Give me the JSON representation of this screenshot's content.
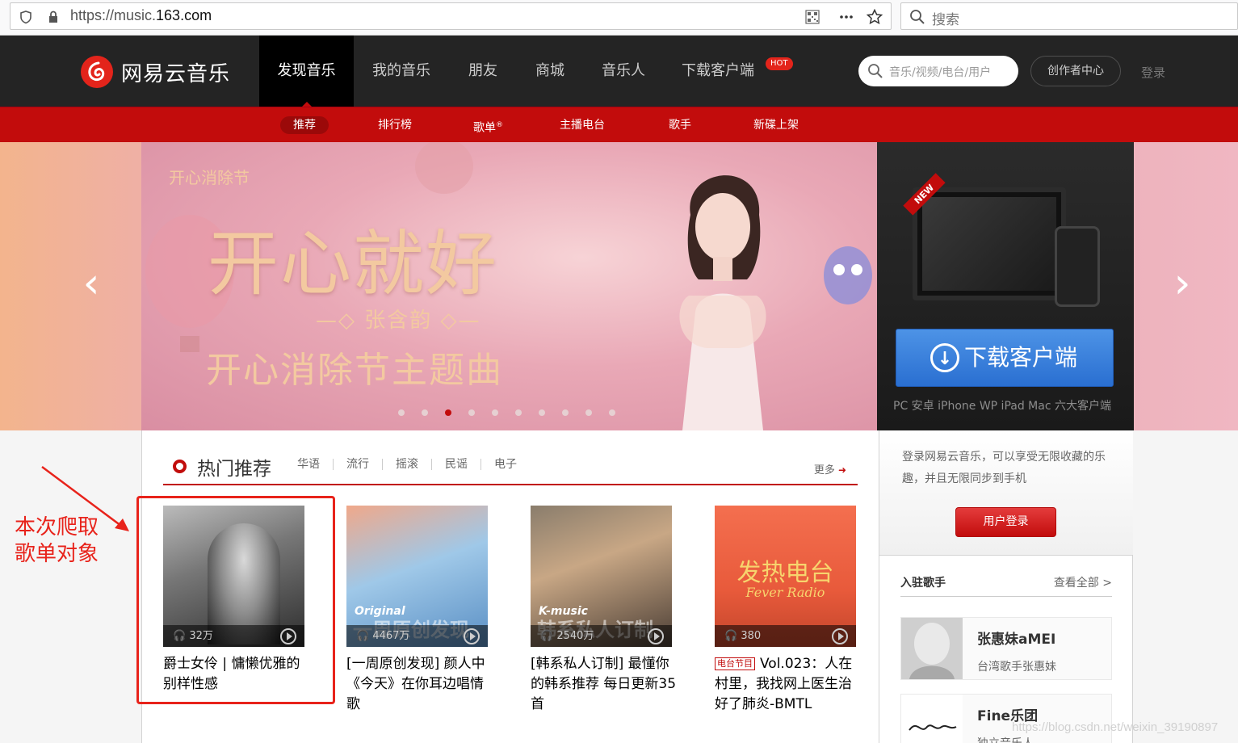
{
  "browser": {
    "url_prefix": "https://music.",
    "url_domain": "163.com",
    "search_placeholder": "搜索"
  },
  "topnav": {
    "logo": "网易云音乐",
    "items": [
      "发现音乐",
      "我的音乐",
      "朋友",
      "商城",
      "音乐人",
      "下载客户端"
    ],
    "hot_badge": "HOT",
    "search_placeholder": "音乐/视频/电台/用户",
    "creator": "创作者中心",
    "login": "登录"
  },
  "subnav": {
    "items": [
      "推荐",
      "排行榜",
      "歌单",
      "主播电台",
      "歌手",
      "新碟上架"
    ],
    "reg_mark": "®"
  },
  "banner": {
    "logo": "开心消除节",
    "title": "开心就好",
    "artist": "张含韵",
    "subtitle": "开心消除节主题曲",
    "new_tag": "NEW",
    "download_label": "下载客户端",
    "download_note": "PC 安卓 iPhone WP iPad Mac 六大客户端",
    "dots_count": 10,
    "active_dot": 2
  },
  "hot": {
    "title": "热门推荐",
    "tags": [
      "华语",
      "流行",
      "摇滚",
      "民谣",
      "电子"
    ],
    "more": "更多",
    "cards": [
      {
        "plays": "32万",
        "title": "爵士女伶 | 慵懒优雅的别样性感",
        "label": "",
        "big": ""
      },
      {
        "plays": "4467万",
        "title": "[一周原创发现] 颜人中《今天》在你耳边唱情歌",
        "label": "Original",
        "big": "一周原创发现"
      },
      {
        "plays": "2540万",
        "title": "[韩系私人订制] 最懂你的韩系推荐 每日更新35首",
        "label": "K-music",
        "big": "韩系私人订制"
      },
      {
        "plays": "380",
        "title": "Vol.023：人在村里，我找网上医生治好了肺炎-BMTL",
        "radio_tag": "电台节目",
        "cover_title": "发热电台",
        "cover_sub": "Fever Radio"
      }
    ]
  },
  "annotation": {
    "line1": "本次爬取",
    "line2": "歌单对象"
  },
  "sidebar": {
    "login_text": "登录网易云音乐，可以享受无限收藏的乐趣，并且无限同步到手机",
    "login_button": "用户登录",
    "singers_title": "入驻歌手",
    "view_all": "查看全部 >",
    "singers": [
      {
        "name": "张惠妹aMEI",
        "desc": "台湾歌手张惠妹"
      },
      {
        "name": "Fine乐团",
        "desc": "独立音乐人"
      }
    ]
  },
  "watermark": "https://blog.csdn.net/weixin_39190897",
  "colors": {
    "brand_red": "#c20c0c",
    "nav_bg": "#242424",
    "annotation_red": "#e8231b"
  }
}
